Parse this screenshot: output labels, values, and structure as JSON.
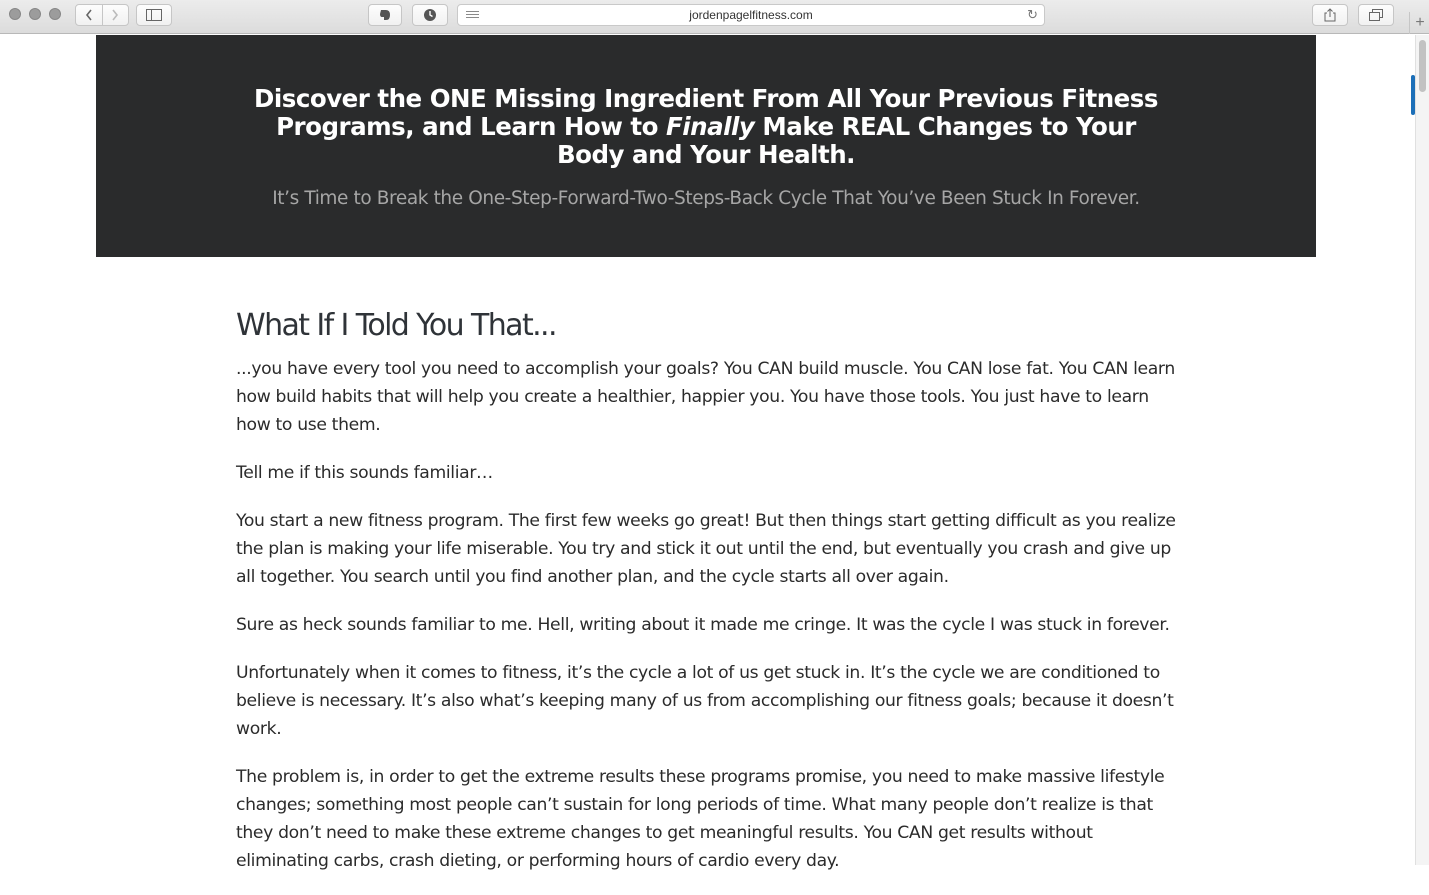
{
  "browser": {
    "url": "jordenpagelfitness.com"
  },
  "hero": {
    "title_part1": "Discover the ONE Missing Ingredient From All Your Previous Fitness Programs, and Learn How to ",
    "title_emphasis": "Finally",
    "title_part2": " Make REAL Changes to Your Body and Your Health.",
    "subtitle": "It’s Time to Break the One-Step-Forward-Two-Steps-Back Cycle That You’ve Been Stuck In Forever."
  },
  "article": {
    "heading": "What If I Told You That...",
    "paragraphs": [
      "...you have every tool you need to accomplish your goals? You CAN build muscle. You CAN lose fat. You CAN learn how build habits that will help you create a healthier, happier you. You have those tools. You just have to learn how to use them.",
      "Tell me if this sounds familiar…",
      "You start a new fitness program. The first few weeks go great! But then things start getting difficult as you realize the plan is making your life miserable. You try and stick it out until the end, but eventually you crash and give up all together. You search until you find another plan, and the cycle starts all over again.",
      "Sure as heck sounds familiar to me. Hell, writing about it made me cringe. It was the cycle I was stuck in forever.",
      "Unfortunately when it comes to fitness, it’s the cycle a lot of us get stuck in. It’s the cycle we are conditioned to believe is necessary. It’s also what’s keeping many of us from accomplishing our fitness goals; because it doesn’t work.",
      "The problem is, in order to get the extreme results these programs promise, you need to make massive lifestyle changes; something most people can’t sustain for long periods of time. What many people don’t realize is that they don’t need to make these extreme changes to get meaningful results. You CAN get results without eliminating carbs, crash dieting, or performing hours of cardio every day."
    ]
  },
  "colors": {
    "hero_background": "#2a2b2c",
    "hero_subtitle": "#a6a6a6",
    "body_text": "#2b2b2b"
  }
}
